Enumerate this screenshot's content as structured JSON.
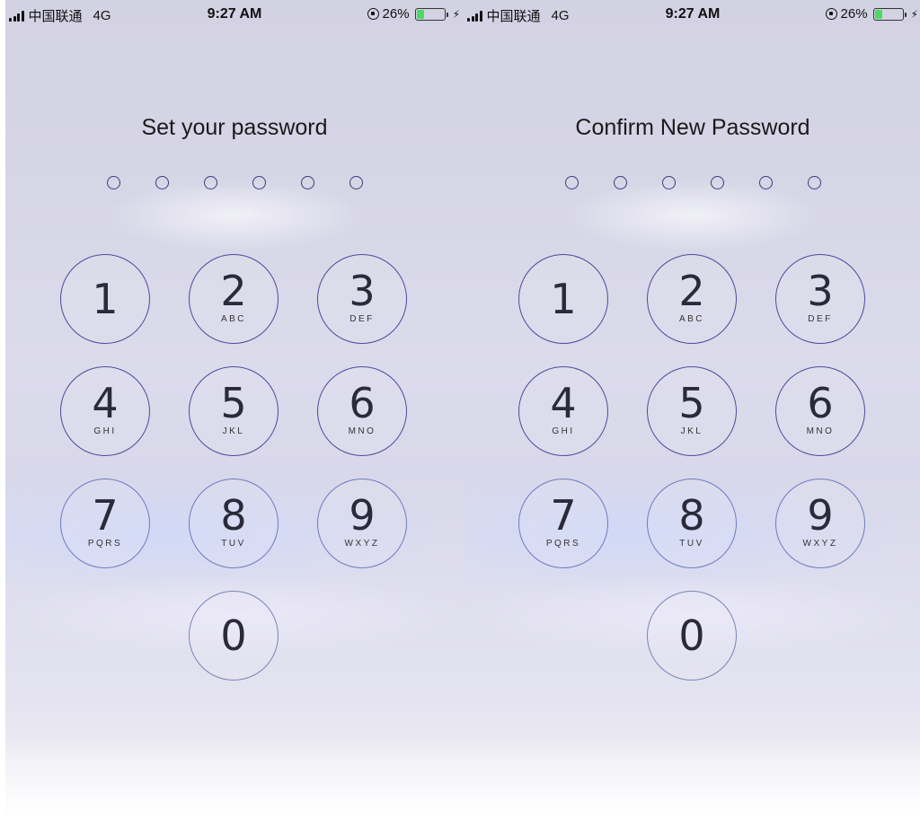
{
  "status_bar": {
    "carrier": "中国联通",
    "network": "4G",
    "time": "9:27 AM",
    "battery_percent_label": "26%",
    "battery_level": 0.26,
    "battery_color": "#4cd964",
    "icons": [
      "signal-icon",
      "orientation-lock-icon",
      "battery-icon",
      "charging-bolt-icon"
    ]
  },
  "screens": [
    {
      "title": "Set your password",
      "dots_count": 6,
      "keys": [
        {
          "digit": "1",
          "letters": ""
        },
        {
          "digit": "2",
          "letters": "ABC"
        },
        {
          "digit": "3",
          "letters": "DEF"
        },
        {
          "digit": "4",
          "letters": "GHI"
        },
        {
          "digit": "5",
          "letters": "JKL"
        },
        {
          "digit": "6",
          "letters": "MNO"
        },
        {
          "digit": "7",
          "letters": "PQRS"
        },
        {
          "digit": "8",
          "letters": "TUV"
        },
        {
          "digit": "9",
          "letters": "WXYZ"
        },
        {
          "digit": "0",
          "letters": ""
        }
      ]
    },
    {
      "title": "Confirm New Password",
      "dots_count": 6,
      "keys": [
        {
          "digit": "1",
          "letters": ""
        },
        {
          "digit": "2",
          "letters": "ABC"
        },
        {
          "digit": "3",
          "letters": "DEF"
        },
        {
          "digit": "4",
          "letters": "GHI"
        },
        {
          "digit": "5",
          "letters": "JKL"
        },
        {
          "digit": "6",
          "letters": "MNO"
        },
        {
          "digit": "7",
          "letters": "PQRS"
        },
        {
          "digit": "8",
          "letters": "TUV"
        },
        {
          "digit": "9",
          "letters": "WXYZ"
        },
        {
          "digit": "0",
          "letters": ""
        }
      ]
    }
  ]
}
